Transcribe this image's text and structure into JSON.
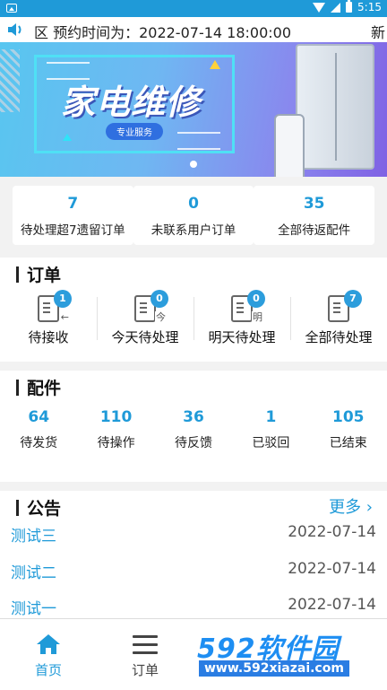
{
  "status_bar": {
    "time": "5:15"
  },
  "notice_bar": {
    "text": "区 预约时间为：2022-07-14 18:00:00",
    "tail": "新"
  },
  "banner": {
    "title": "家电维修",
    "subtitle": "专业服务"
  },
  "stats": [
    {
      "value": "7",
      "label": "待处理超7遗留订单"
    },
    {
      "value": "0",
      "label": "未联系用户订单"
    },
    {
      "value": "35",
      "label": "全部待返配件"
    }
  ],
  "orders": {
    "title": "订单",
    "items": [
      {
        "badge": "1",
        "label": "待接收",
        "icon": "doc-arrow-icon",
        "sub": "←"
      },
      {
        "badge": "0",
        "label": "今天待处理",
        "icon": "doc-today-icon",
        "sub": "今"
      },
      {
        "badge": "0",
        "label": "明天待处理",
        "icon": "doc-tomorrow-icon",
        "sub": "明"
      },
      {
        "badge": "7",
        "label": "全部待处理",
        "icon": "doc-all-icon",
        "sub": ""
      }
    ]
  },
  "parts": {
    "title": "配件",
    "items": [
      {
        "value": "64",
        "label": "待发货"
      },
      {
        "value": "110",
        "label": "待操作"
      },
      {
        "value": "36",
        "label": "待反馈"
      },
      {
        "value": "1",
        "label": "已驳回"
      },
      {
        "value": "105",
        "label": "已结束"
      }
    ]
  },
  "announcements": {
    "title": "公告",
    "more": "更多 ›",
    "items": [
      {
        "title": "测试三",
        "date": "2022-07-14"
      },
      {
        "title": "测试二",
        "date": "2022-07-14"
      },
      {
        "title": "测试一",
        "date": "2022-07-14"
      }
    ]
  },
  "tabbar": {
    "items": [
      {
        "label": "首页",
        "icon": "home-icon",
        "active": true
      },
      {
        "label": "订单",
        "icon": "list-icon",
        "active": false
      }
    ]
  },
  "watermark": {
    "brand": "592软件园",
    "url": "www.592xiazai.com"
  },
  "colors": {
    "accent": "#1f9ad8",
    "badge": "#2c9ddc"
  }
}
